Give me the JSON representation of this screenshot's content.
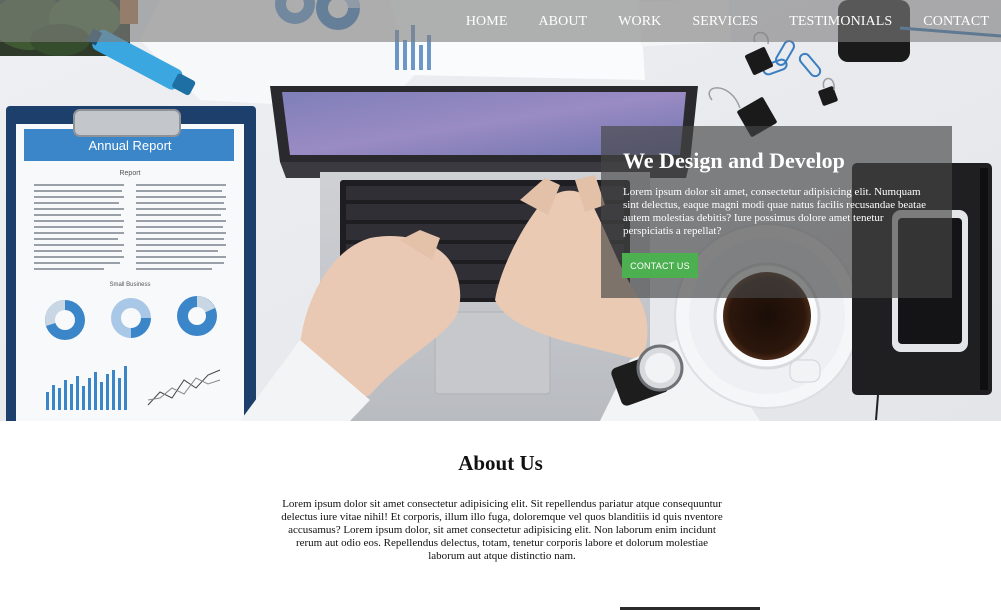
{
  "nav": {
    "items": [
      "HOME",
      "ABOUT",
      "WORK",
      "SERVICES",
      "TESTIMONIALS",
      "CONTACT"
    ]
  },
  "hero": {
    "title": "We Design and Develop",
    "text": "Lorem ipsum dolor sit amet, consectetur adipisicing elit. Numquam sint delectus, eaque magni modi quae natus facilis recusandae beatae autem molestias debitis? Iure possimus dolore amet tenetur perspiciatis a repellat?",
    "button_label": "CONTACT US",
    "report_title": "Annual Report",
    "report_subtitle": "Report",
    "report_section": "Small Business"
  },
  "about": {
    "title": "About Us",
    "text": "Lorem ipsum dolor sit amet consectetur adipisicing elit. Sit repellendus pariatur atque consequuntur delectus iure vitae nihil! Et corporis, illum illo fuga, doloremque vel quos blanditiis id quis nventore accusamus? Lorem ipsum dolor, sit amet consectetur adipisicing elit. Non laborum enim incidunt rerum aut odio eos. Repellendus delectus, totam, tenetur corporis labore et dolorum molestiae laborum aut atque distinctio nam."
  },
  "colors": {
    "accent_green": "#4caf50",
    "nav_overlay": "#808080",
    "report_blue": "#3a86c8"
  }
}
